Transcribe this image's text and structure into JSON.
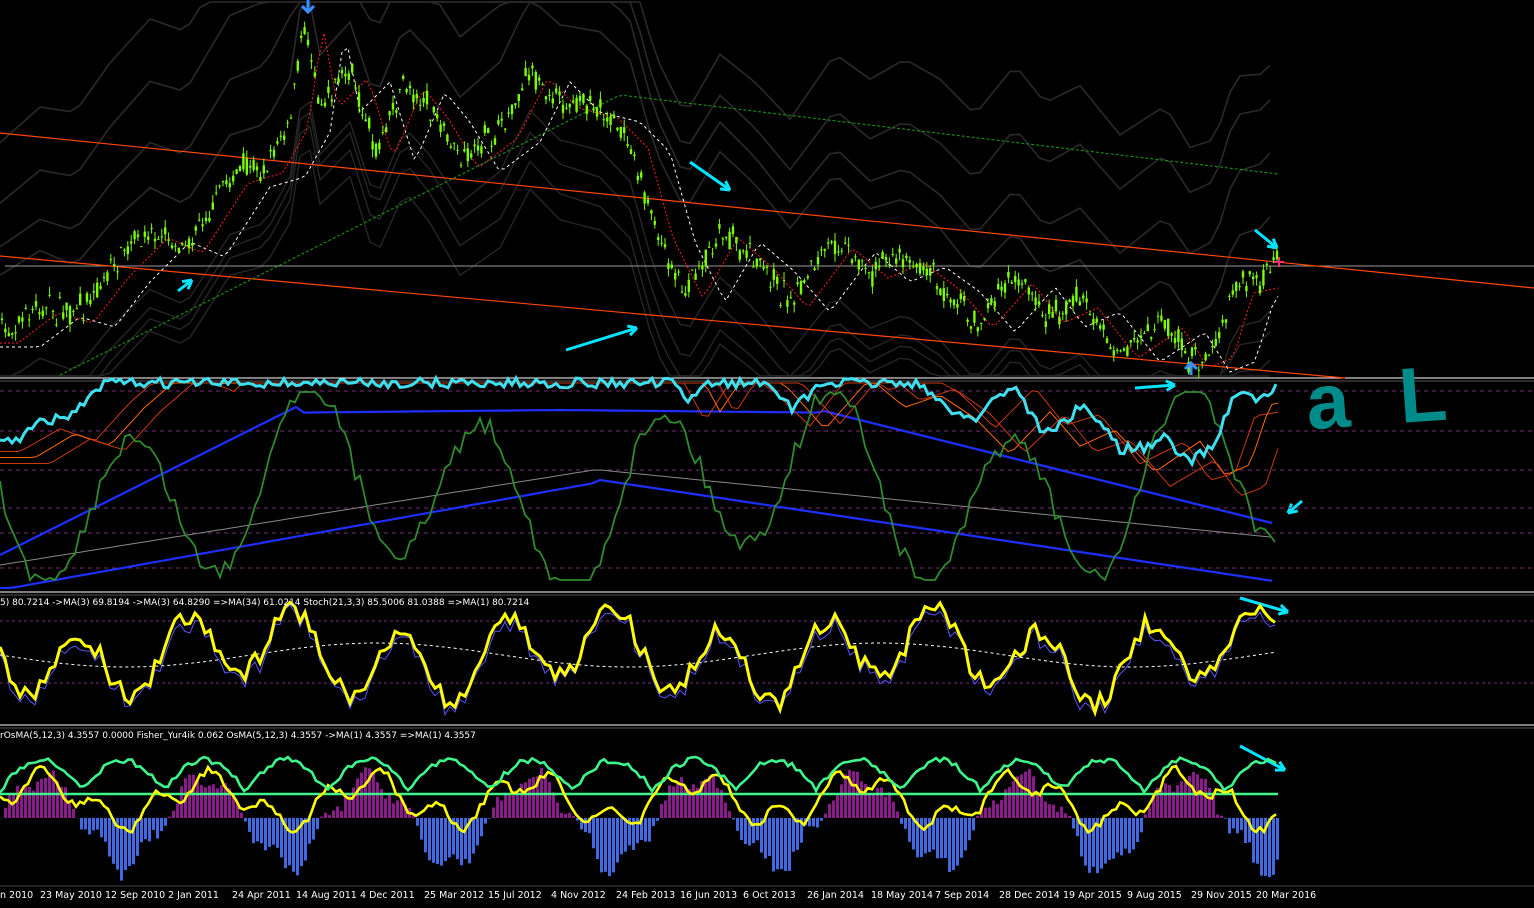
{
  "indicator_legends": {
    "panel3": "5) 80.7214  ->MA(3) 69.8194  ->MA(3) 64.8290  =>MA(34) 61.0214  Stoch(21,3,3) 85.5006 81.0388  =>MA(1) 80.7214",
    "panel4": "rOsMA(5,12,3) 4.3557 0.0000  Fisher_Yur4ik 0.062  OsMA(5,12,3) 4.3557  ->MA(1) 4.3557  =>MA(1) 4.3557"
  },
  "annotation_text": "a L",
  "colors": {
    "background": "#000000",
    "bull_candle": "#7cfc00",
    "trendline": "#ff4500",
    "arrow": "#00e5ff",
    "stoch_main": "#ffff00",
    "osma_line": "#3df58a",
    "hist_pos": "#8b1a8b",
    "hist_neg": "#4169e1",
    "panel2_fast": "#3ee0f0",
    "panel2_green": "#2e8b2e",
    "panel2_blue": "#1e2fff"
  },
  "chart_data": {
    "type": "line",
    "x": [
      "23 May 2010",
      "12 Sep 2010",
      "2 Jan 2011",
      "24 Apr 2011",
      "14 Aug 2011",
      "4 Dec 2011",
      "25 Mar 2012",
      "15 Jul 2012",
      "4 Nov 2012",
      "24 Feb 2013",
      "16 Jun 2013",
      "6 Oct 2013",
      "26 Jan 2014",
      "18 May 2014",
      "7 Sep 2014",
      "28 Dec 2014",
      "19 Apr 2015",
      "9 Aug 2015",
      "29 Nov 2015",
      "20 Mar 2016"
    ],
    "x_first_partial": "n 2010",
    "series": [
      {
        "values": [
          45,
          55,
          62,
          72,
          95,
          80,
          78,
          82,
          80,
          60,
          48,
          48,
          50,
          47,
          46,
          44,
          42,
          40,
          41,
          55
        ]
      }
    ]
  }
}
